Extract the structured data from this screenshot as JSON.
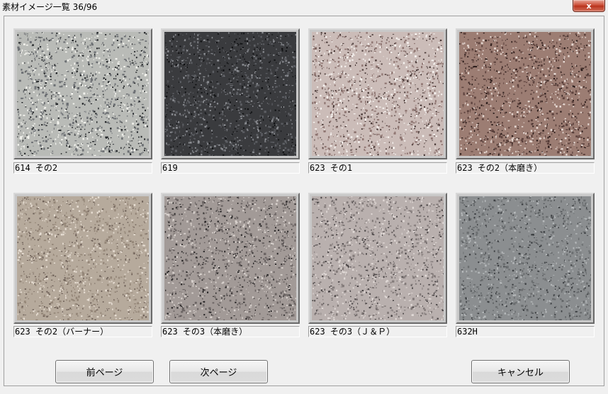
{
  "window": {
    "title": "素材イメージ一覧 36/96",
    "close_glyph": "x"
  },
  "materials": [
    {
      "label": "614 その2",
      "base": "#b9bbb7",
      "dark": "#1f2225",
      "mid": "#6d7074",
      "light": "#f3f3ee"
    },
    {
      "label": "619",
      "base": "#3a3b3e",
      "dark": "#101113",
      "mid": "#5c5e63",
      "light": "#8b8d92"
    },
    {
      "label": "623 その1",
      "base": "#cbbcb8",
      "dark": "#4a3a38",
      "mid": "#8e7571",
      "light": "#f6f2ef"
    },
    {
      "label": "623 その2（本磨き）",
      "base": "#9c7d73",
      "dark": "#2b1c1a",
      "mid": "#5e433e",
      "light": "#e4d6d0"
    },
    {
      "label": "623 その2（バーナー）",
      "base": "#b6aa9c",
      "dark": "#6d5f57",
      "mid": "#958779",
      "light": "#e6ddd2"
    },
    {
      "label": "623 その3（本磨き）",
      "base": "#a29a97",
      "dark": "#2a2829",
      "mid": "#6c6564",
      "light": "#d8d1cd"
    },
    {
      "label": "623 その3（Ｊ＆Ｐ）",
      "base": "#b9b0ae",
      "dark": "#4a4546",
      "mid": "#837b7a",
      "light": "#e1dad7"
    },
    {
      "label": "632H",
      "base": "#8b8e90",
      "dark": "#3d4043",
      "mid": "#6b6e70",
      "light": "#b5b8ba"
    }
  ],
  "buttons": {
    "prev": "前ページ",
    "next": "次ページ",
    "cancel": "キャンセル"
  }
}
